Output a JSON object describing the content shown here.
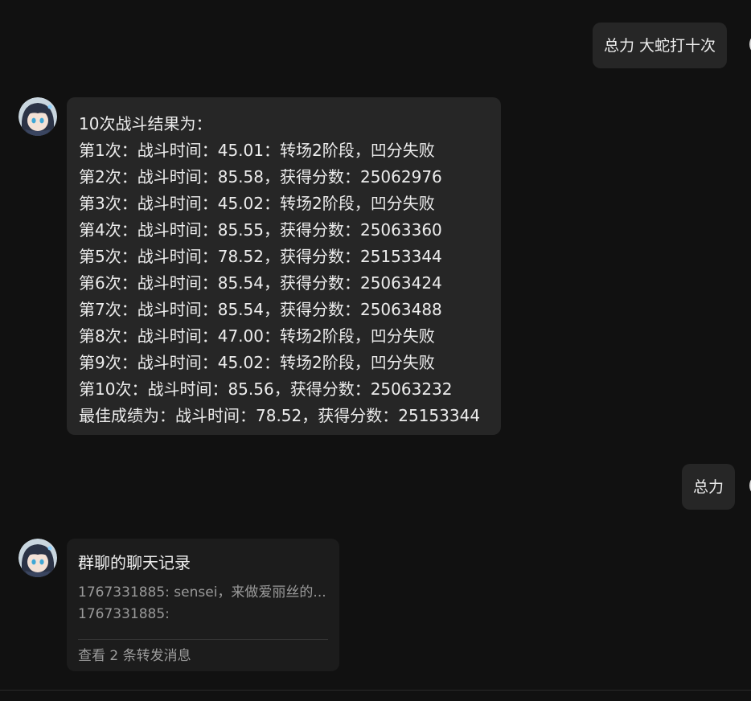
{
  "messages": {
    "user_cmd_1": "总力 大蛇打十次",
    "bot_result": {
      "lines": [
        "10次战斗结果为：",
        "第1次：战斗时间：45.01：转场2阶段，凹分失败",
        "第2次：战斗时间：85.58，获得分数：25062976",
        "第3次：战斗时间：45.02：转场2阶段，凹分失败",
        "第4次：战斗时间：85.55，获得分数：25063360",
        "第5次：战斗时间：78.52，获得分数：25153344",
        "第6次：战斗时间：85.54，获得分数：25063424",
        "第7次：战斗时间：85.54，获得分数：25063488",
        "第8次：战斗时间：47.00：转场2阶段，凹分失败",
        "第9次：战斗时间：45.02：转场2阶段，凹分失败",
        "第10次：战斗时间：85.56，获得分数：25063232",
        "最佳成绩为：战斗时间：78.52，获得分数：25153344"
      ]
    },
    "user_cmd_2": "总力",
    "forward_card": {
      "title": "群聊的聊天记录",
      "preview_1": "1767331885: sensei，来做爱丽丝的...",
      "preview_2": "1767331885:",
      "footer": "查看 2 条转发消息"
    }
  },
  "icons": {
    "bot_avatar": "anime-girl-avatar-icon",
    "user_avatar": "user-avatar-icon"
  },
  "colors": {
    "background": "#111111",
    "bubble": "#262626",
    "card": "#1c1c1c",
    "text": "#ececec",
    "muted": "#9a9a9a"
  }
}
